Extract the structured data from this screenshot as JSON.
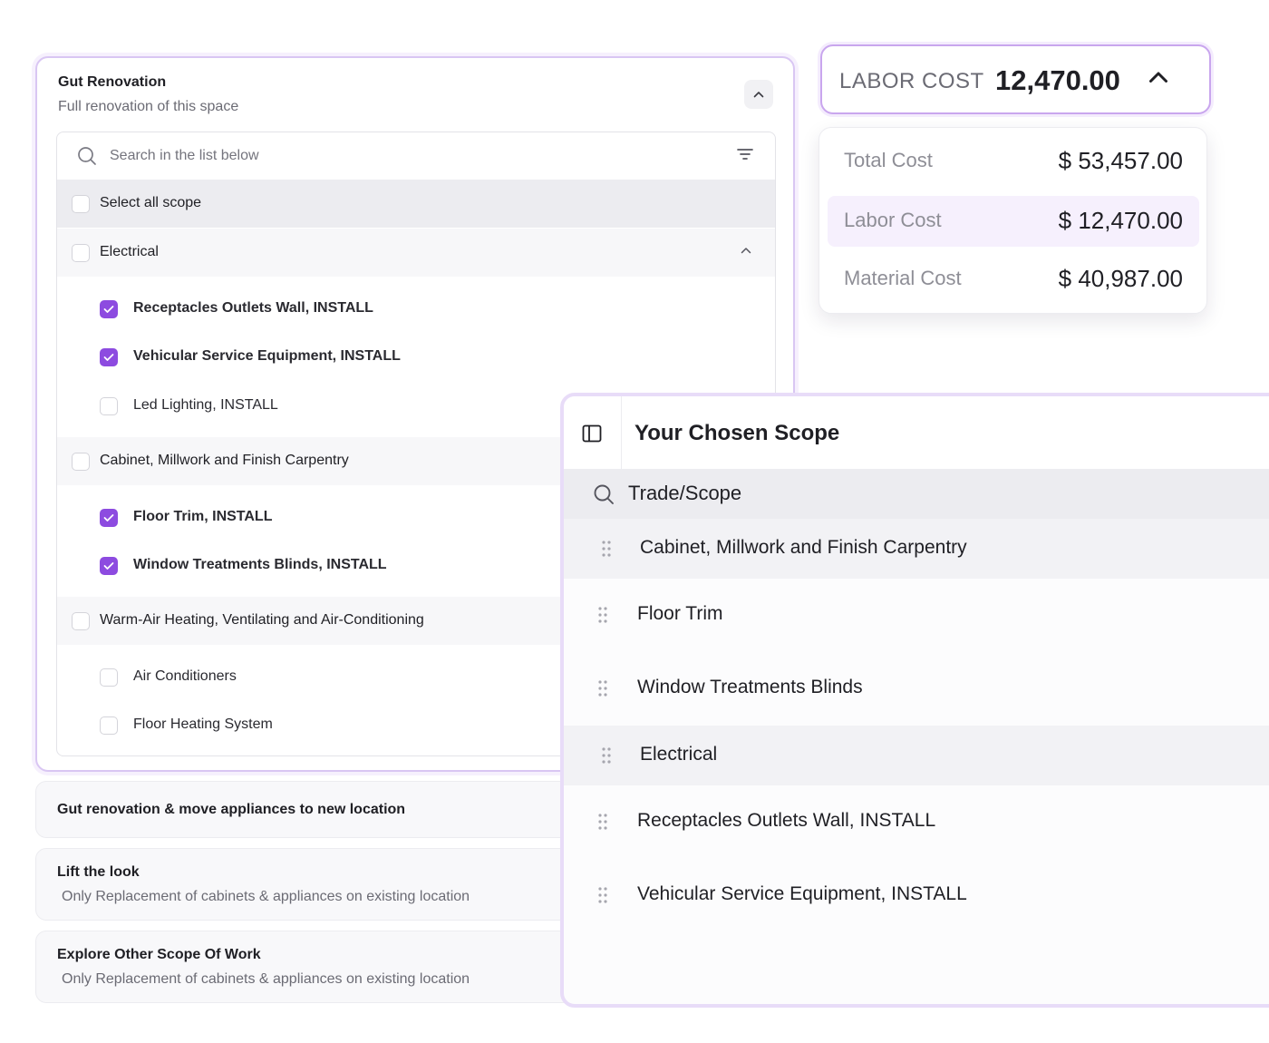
{
  "main_card": {
    "title": "Gut Renovation",
    "subtitle": "Full renovation of this space",
    "search_placeholder": "Search in the list below",
    "select_all_label": "Select all scope",
    "groups": [
      {
        "label": "Electrical",
        "items": [
          {
            "label": "Receptacles Outlets Wall, INSTALL",
            "checked": true
          },
          {
            "label": "Vehicular Service Equipment, INSTALL",
            "checked": true
          },
          {
            "label": "Led Lighting, INSTALL",
            "checked": false
          }
        ]
      },
      {
        "label": "Cabinet, Millwork and Finish Carpentry",
        "items": [
          {
            "label": "Floor Trim, INSTALL",
            "checked": true
          },
          {
            "label": "Window Treatments Blinds, INSTALL",
            "checked": true
          }
        ]
      },
      {
        "label": "Warm-Air Heating, Ventilating and Air-Conditioning",
        "items": [
          {
            "label": "Air Conditioners",
            "checked": false
          },
          {
            "label": "Floor Heating System",
            "checked": false
          }
        ]
      }
    ]
  },
  "options": [
    {
      "title": "Gut renovation & move appliances to new location",
      "subtitle": ""
    },
    {
      "title": "Lift the look",
      "subtitle": "Only Replacement of cabinets & appliances on existing location"
    },
    {
      "title": "Explore Other Scope Of Work",
      "subtitle": "Only Replacement of cabinets & appliances on existing location"
    }
  ],
  "labor_pill": {
    "label": "LABOR COST",
    "value": "12,470.00"
  },
  "cost_breakdown": [
    {
      "label": "Total Cost",
      "value": "$ 53,457.00",
      "highlighted": false
    },
    {
      "label": "Labor Cost",
      "value": "$ 12,470.00",
      "highlighted": true
    },
    {
      "label": "Material Cost",
      "value": "$ 40,987.00",
      "highlighted": false
    }
  ],
  "scope_panel": {
    "title": "Your Chosen Scope",
    "column_label": "Trade/Scope",
    "rows": [
      {
        "label": "Cabinet, Millwork and Finish Carpentry",
        "kind": "group"
      },
      {
        "label": "Floor Trim",
        "kind": "item"
      },
      {
        "label": "Window Treatments Blinds",
        "kind": "item"
      },
      {
        "label": "Electrical",
        "kind": "group"
      },
      {
        "label": "Receptacles Outlets Wall, INSTALL",
        "kind": "item"
      },
      {
        "label": "Vehicular Service Equipment, INSTALL",
        "kind": "item"
      }
    ]
  },
  "colors": {
    "accent": "#8d4be0",
    "accent_border": "#d9c6f3",
    "highlight_bg": "#f6f0fd"
  }
}
